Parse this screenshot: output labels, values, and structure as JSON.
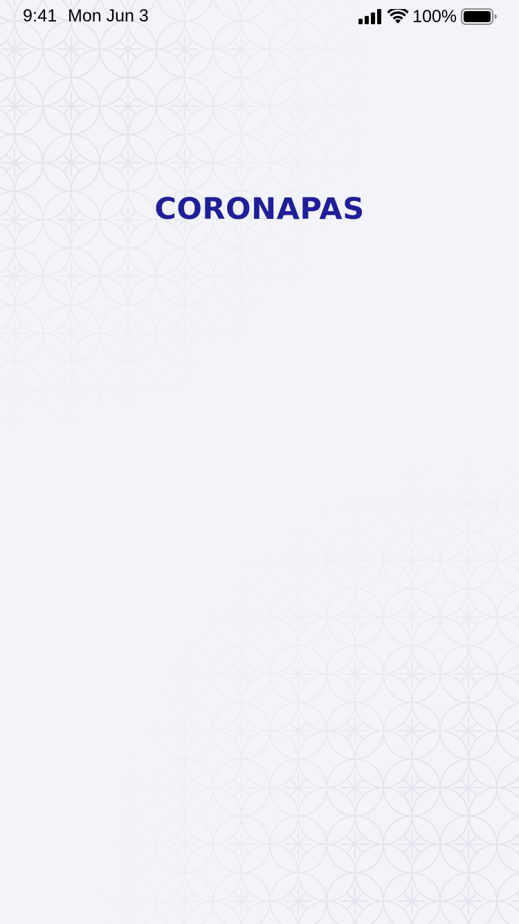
{
  "status_bar": {
    "time": "9:41",
    "date": "Mon Jun 3",
    "battery_percent": "100%",
    "signal_icon": "cellular-signal-icon",
    "wifi_icon": "wifi-icon",
    "battery_icon": "battery-icon"
  },
  "splash": {
    "title": "CORONAPAS"
  },
  "colors": {
    "background": "#f3f4f9",
    "brand": "#1f1f99",
    "pattern_stroke": "#e4e4ec"
  }
}
